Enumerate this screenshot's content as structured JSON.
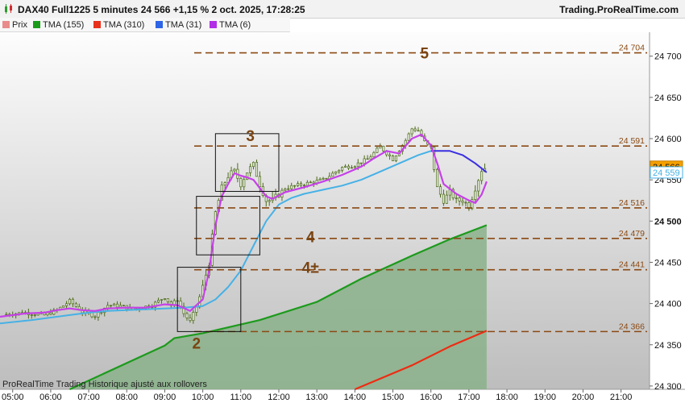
{
  "header": {
    "title": "DAX40 Full1225 5 minutes 24 566 +1,15 % 2 oct. 2025, 17:28:25",
    "brand": "Trading.ProRealTime.com"
  },
  "legend": [
    {
      "label": "Prix",
      "color": "#e98b8b"
    },
    {
      "label": "TMA (155)",
      "color": "#1a9c1a"
    },
    {
      "label": "TMA (310)",
      "color": "#e8321c"
    },
    {
      "label": "TMA (31)",
      "color": "#2e64e6"
    },
    {
      "label": "TMA (6)",
      "color": "#b12ee6"
    }
  ],
  "footnote": "ProRealTime Trading  Historique ajusté aux rollovers",
  "colors": {
    "price_bars": "#4d6b1a",
    "tma6": "#c640e8",
    "tma31": "#46b1e6",
    "tma31_late": "#3a2fe0",
    "tma155": "#1d9a1d",
    "tma155_fill": "#89b289",
    "tma310": "#ee2b12",
    "levels": "#8b4a14",
    "counts": "#7a4412",
    "badge_price": "#f5a000",
    "badge_tma31": "#ffffff"
  },
  "chart_data": {
    "type": "candlestick",
    "instrument": "DAX40 Full1225",
    "timeframe": "5 minutes",
    "x_ticks": [
      "05:00",
      "06:00",
      "07:00",
      "08:00",
      "09:00",
      "10:00",
      "11:00",
      "12:00",
      "13:00",
      "14:00",
      "15:00",
      "16:00",
      "17:00",
      "18:00",
      "19:00",
      "20:00",
      "21:00"
    ],
    "y_ticks": [
      "24 700",
      "24 650",
      "24 600",
      "24 550",
      "24 500",
      "24 450",
      "24 400",
      "24 350",
      "24 300"
    ],
    "y_tick_values": [
      24700,
      24650,
      24600,
      24550,
      24500,
      24450,
      24400,
      24350,
      24300
    ],
    "ylim": [
      24296,
      24729
    ],
    "xlim": [
      "04:40",
      "21:45"
    ],
    "price_series": [
      {
        "t": "04:50",
        "v": 24387
      },
      {
        "t": "05:20",
        "v": 24389
      },
      {
        "t": "05:50",
        "v": 24386
      },
      {
        "t": "06:10",
        "v": 24392
      },
      {
        "t": "06:30",
        "v": 24403
      },
      {
        "t": "06:50",
        "v": 24390
      },
      {
        "t": "07:10",
        "v": 24385
      },
      {
        "t": "07:30",
        "v": 24398
      },
      {
        "t": "07:50",
        "v": 24397
      },
      {
        "t": "08:10",
        "v": 24393
      },
      {
        "t": "08:40",
        "v": 24398
      },
      {
        "t": "09:00",
        "v": 24408
      },
      {
        "t": "09:10",
        "v": 24398
      },
      {
        "t": "09:20",
        "v": 24405
      },
      {
        "t": "09:30",
        "v": 24388
      },
      {
        "t": "09:40",
        "v": 24378
      },
      {
        "t": "09:50",
        "v": 24396
      },
      {
        "t": "10:00",
        "v": 24420
      },
      {
        "t": "10:10",
        "v": 24450
      },
      {
        "t": "10:20",
        "v": 24510
      },
      {
        "t": "10:30",
        "v": 24540
      },
      {
        "t": "10:40",
        "v": 24555
      },
      {
        "t": "10:50",
        "v": 24560
      },
      {
        "t": "11:00",
        "v": 24545
      },
      {
        "t": "11:10",
        "v": 24560
      },
      {
        "t": "11:20",
        "v": 24568
      },
      {
        "t": "11:30",
        "v": 24545
      },
      {
        "t": "11:40",
        "v": 24525
      },
      {
        "t": "11:50",
        "v": 24525
      },
      {
        "t": "12:10",
        "v": 24540
      },
      {
        "t": "12:40",
        "v": 24545
      },
      {
        "t": "13:10",
        "v": 24550
      },
      {
        "t": "13:40",
        "v": 24565
      },
      {
        "t": "14:00",
        "v": 24568
      },
      {
        "t": "14:20",
        "v": 24575
      },
      {
        "t": "14:40",
        "v": 24590
      },
      {
        "t": "15:00",
        "v": 24575
      },
      {
        "t": "15:20",
        "v": 24598
      },
      {
        "t": "15:30",
        "v": 24612
      },
      {
        "t": "15:40",
        "v": 24610
      },
      {
        "t": "15:50",
        "v": 24596
      },
      {
        "t": "16:00",
        "v": 24588
      },
      {
        "t": "16:10",
        "v": 24540
      },
      {
        "t": "16:20",
        "v": 24525
      },
      {
        "t": "16:30",
        "v": 24535
      },
      {
        "t": "16:40",
        "v": 24525
      },
      {
        "t": "16:50",
        "v": 24525
      },
      {
        "t": "17:00",
        "v": 24518
      },
      {
        "t": "17:10",
        "v": 24540
      },
      {
        "t": "17:20",
        "v": 24562
      },
      {
        "t": "17:28",
        "v": 24566
      }
    ],
    "series": [
      {
        "name": "TMA (6)",
        "points": [
          {
            "t": "04:40",
            "v": 24384
          },
          {
            "t": "05:20",
            "v": 24388
          },
          {
            "t": "05:50",
            "v": 24389
          },
          {
            "t": "06:10",
            "v": 24392
          },
          {
            "t": "06:30",
            "v": 24394
          },
          {
            "t": "06:50",
            "v": 24392
          },
          {
            "t": "07:10",
            "v": 24391
          },
          {
            "t": "07:30",
            "v": 24394
          },
          {
            "t": "08:00",
            "v": 24395
          },
          {
            "t": "08:30",
            "v": 24395
          },
          {
            "t": "09:00",
            "v": 24399
          },
          {
            "t": "09:20",
            "v": 24398
          },
          {
            "t": "09:40",
            "v": 24391
          },
          {
            "t": "10:00",
            "v": 24405
          },
          {
            "t": "10:10",
            "v": 24440
          },
          {
            "t": "10:20",
            "v": 24495
          },
          {
            "t": "10:30",
            "v": 24530
          },
          {
            "t": "10:40",
            "v": 24545
          },
          {
            "t": "10:50",
            "v": 24558
          },
          {
            "t": "11:00",
            "v": 24555
          },
          {
            "t": "11:10",
            "v": 24553
          },
          {
            "t": "11:20",
            "v": 24550
          },
          {
            "t": "11:30",
            "v": 24540
          },
          {
            "t": "11:40",
            "v": 24530
          },
          {
            "t": "11:50",
            "v": 24527
          },
          {
            "t": "12:10",
            "v": 24535
          },
          {
            "t": "12:40",
            "v": 24541
          },
          {
            "t": "13:10",
            "v": 24548
          },
          {
            "t": "13:40",
            "v": 24556
          },
          {
            "t": "14:10",
            "v": 24566
          },
          {
            "t": "14:30",
            "v": 24576
          },
          {
            "t": "14:50",
            "v": 24585
          },
          {
            "t": "15:10",
            "v": 24582
          },
          {
            "t": "15:30",
            "v": 24600
          },
          {
            "t": "15:45",
            "v": 24605
          },
          {
            "t": "16:00",
            "v": 24592
          },
          {
            "t": "16:10",
            "v": 24570
          },
          {
            "t": "16:20",
            "v": 24545
          },
          {
            "t": "16:40",
            "v": 24533
          },
          {
            "t": "17:00",
            "v": 24525
          },
          {
            "t": "17:10",
            "v": 24522
          },
          {
            "t": "17:20",
            "v": 24532
          },
          {
            "t": "17:28",
            "v": 24548
          }
        ]
      },
      {
        "name": "TMA (31)",
        "points": [
          {
            "t": "04:40",
            "v": 24376
          },
          {
            "t": "05:30",
            "v": 24380
          },
          {
            "t": "06:00",
            "v": 24383
          },
          {
            "t": "06:30",
            "v": 24386
          },
          {
            "t": "07:00",
            "v": 24389
          },
          {
            "t": "07:30",
            "v": 24391
          },
          {
            "t": "08:00",
            "v": 24392
          },
          {
            "t": "08:30",
            "v": 24393
          },
          {
            "t": "09:00",
            "v": 24394
          },
          {
            "t": "09:30",
            "v": 24395
          },
          {
            "t": "10:00",
            "v": 24397
          },
          {
            "t": "10:20",
            "v": 24405
          },
          {
            "t": "10:40",
            "v": 24420
          },
          {
            "t": "11:00",
            "v": 24440
          },
          {
            "t": "11:20",
            "v": 24470
          },
          {
            "t": "11:40",
            "v": 24500
          },
          {
            "t": "12:00",
            "v": 24520
          },
          {
            "t": "12:20",
            "v": 24528
          },
          {
            "t": "12:40",
            "v": 24533
          },
          {
            "t": "13:10",
            "v": 24538
          },
          {
            "t": "13:40",
            "v": 24543
          },
          {
            "t": "14:10",
            "v": 24550
          },
          {
            "t": "14:40",
            "v": 24560
          },
          {
            "t": "15:10",
            "v": 24570
          },
          {
            "t": "15:40",
            "v": 24580
          },
          {
            "t": "16:00",
            "v": 24585
          }
        ]
      },
      {
        "name": "TMA (31) projection",
        "points": [
          {
            "t": "16:00",
            "v": 24585
          },
          {
            "t": "16:30",
            "v": 24585
          },
          {
            "t": "16:50",
            "v": 24580
          },
          {
            "t": "17:10",
            "v": 24570
          },
          {
            "t": "17:28",
            "v": 24559
          }
        ]
      },
      {
        "name": "TMA (155)",
        "points": [
          {
            "t": "06:30",
            "v": 24296
          },
          {
            "t": "09:00",
            "v": 24349
          },
          {
            "t": "09:15",
            "v": 24358
          },
          {
            "t": "10:00",
            "v": 24364
          },
          {
            "t": "11:30",
            "v": 24380
          },
          {
            "t": "13:00",
            "v": 24402
          },
          {
            "t": "14:10",
            "v": 24430
          },
          {
            "t": "15:30",
            "v": 24458
          },
          {
            "t": "16:30",
            "v": 24478
          },
          {
            "t": "17:28",
            "v": 24495
          }
        ]
      },
      {
        "name": "TMA (310)",
        "points": [
          {
            "t": "14:00",
            "v": 24296
          },
          {
            "t": "15:30",
            "v": 24325
          },
          {
            "t": "16:30",
            "v": 24348
          },
          {
            "t": "17:28",
            "v": 24367
          }
        ]
      }
    ],
    "levels": [
      {
        "value": 24704,
        "label": "24 704"
      },
      {
        "value": 24591,
        "label": "24 591"
      },
      {
        "value": 24516,
        "label": "24 516"
      },
      {
        "value": 24479,
        "label": "24 479"
      },
      {
        "value": 24441,
        "label": "24 441"
      },
      {
        "value": 24366,
        "label": "24 366"
      }
    ],
    "annotations": [
      {
        "text": "5",
        "t": "15:50",
        "v": 24704
      },
      {
        "text": "3",
        "t": "11:15",
        "v": 24604
      },
      {
        "text": "4",
        "t": "12:50",
        "v": 24481
      },
      {
        "text": "4±",
        "t": "12:50",
        "v": 24444
      },
      {
        "text": "2",
        "t": "09:50",
        "v": 24352
      }
    ],
    "boxes": [
      {
        "t0": "10:20",
        "t1": "12:00",
        "v0": 24536,
        "v1": 24606
      },
      {
        "t0": "09:50",
        "t1": "11:30",
        "v0": 24459,
        "v1": 24530
      },
      {
        "t0": "09:20",
        "t1": "11:00",
        "v0": 24366,
        "v1": 24444
      }
    ],
    "price_badges": [
      {
        "label": "24 566",
        "value": 24566,
        "kind": "price"
      },
      {
        "label": "24 559",
        "value": 24559,
        "kind": "tma31"
      }
    ]
  }
}
